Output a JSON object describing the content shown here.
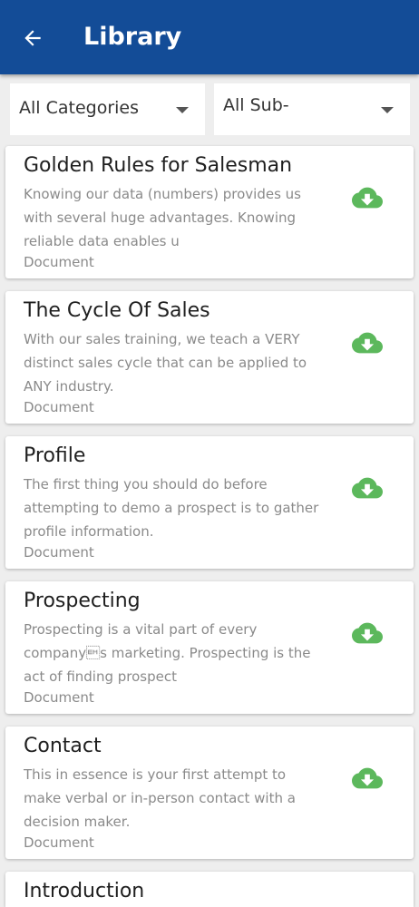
{
  "appbar": {
    "title": "Library",
    "back_icon": "arrow-left-icon",
    "background": "#134c97"
  },
  "filters": {
    "category": "All Categories",
    "subcategory": "All Sub-"
  },
  "items": [
    {
      "title": "Golden Rules for Salesman",
      "description": "Knowing our data (numbers) provides us with several huge advantages. Knowing reliable data enables u",
      "type": "Document",
      "icon": "cloud-download-icon"
    },
    {
      "title": "The Cycle Of Sales",
      "description": "With our sales training, we teach a VERY distinct sales cycle that can be applied to ANY industry.",
      "type": "Document",
      "icon": "cloud-download-icon"
    },
    {
      "title": "Profile",
      "description": "The first thing you should do before attempting to demo a prospect is to gather profile information.",
      "type": "Document",
      "icon": "cloud-download-icon"
    },
    {
      "title": "Prospecting",
      "description": "Prospecting is a vital part of every company\u0019s marketing. Prospecting is the act of finding prospect",
      "type": "Document",
      "icon": "cloud-download-icon"
    },
    {
      "title": "Contact",
      "description": "This in essence is your first attempt to make verbal or in-person contact with a decision maker.",
      "type": "Document",
      "icon": "cloud-download-icon"
    },
    {
      "title": "Introduction"
    }
  ],
  "colors": {
    "download_icon": "#5cb85c",
    "title_text": "#1f1f1f",
    "secondary_text": "#8a8a8a"
  }
}
